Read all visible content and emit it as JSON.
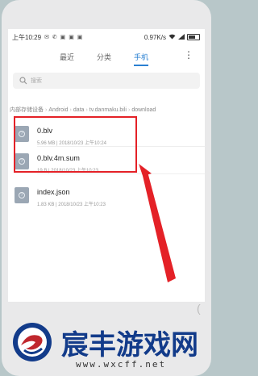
{
  "statusbar": {
    "time": "上午10:29",
    "icons": "✉ ✆ ▣ ▣ ▣",
    "speed": "0.97K/s"
  },
  "tabs": [
    {
      "label": "最近"
    },
    {
      "label": "分类"
    },
    {
      "label": "手机"
    }
  ],
  "search": {
    "placeholder": "搜索"
  },
  "breadcrumb": [
    "内部存储设备",
    "Android",
    "data",
    "tv.danmaku.bili",
    "download"
  ],
  "files": [
    {
      "name": "0.blv",
      "size": "5.96 MB",
      "date": "2018/10/23 上午10:24"
    },
    {
      "name": "0.blv.4m.sum",
      "size": "19 B",
      "date": "2018/10/23 上午10:23"
    },
    {
      "name": "index.json",
      "size": "1.83 KB",
      "date": "2018/10/23 上午10:23"
    }
  ],
  "watermark": {
    "brand": "宸丰游戏网",
    "url": "www.wxcff.net"
  },
  "colors": {
    "accent": "#2a80d2",
    "highlight": "#e42127",
    "brand": "#123b8a"
  }
}
